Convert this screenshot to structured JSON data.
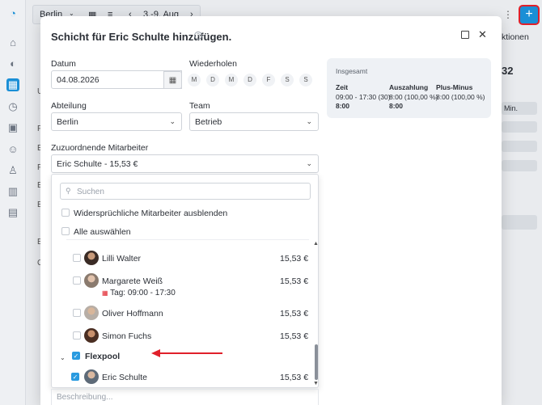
{
  "background": {
    "location": "Berlin",
    "date_range": "3.-9. Aug",
    "actions_label": "ktionen",
    "side_letters": [
      "U",
      "F",
      "E",
      "F",
      "E",
      "E",
      "E",
      "C"
    ],
    "right_value": "32",
    "right_badge": "Min."
  },
  "modal": {
    "title": "Schicht für Eric Schulte hinzufügen.",
    "date_label": "Datum",
    "date_value": "04.08.2026",
    "repeat_label": "Wiederholen",
    "weekdays": [
      "M",
      "D",
      "M",
      "D",
      "F",
      "S",
      "S"
    ],
    "department_label": "Abteilung",
    "department_value": "Berlin",
    "team_label": "Team",
    "team_value": "Betrieb",
    "employees_label": "Zuzuordnende Mitarbeiter",
    "employees_value": "Eric Schulte - 15,53 €",
    "description_placeholder": "Beschreibung..."
  },
  "summary": {
    "title": "Insgesamt",
    "columns": [
      {
        "header": "Zeit",
        "line1": "09:00 - 17:30 (30)",
        "line2": "8:00"
      },
      {
        "header": "Auszahlung",
        "line1": "8:00 (100,00 %)",
        "line2": "8:00"
      },
      {
        "header": "Plus-Minus",
        "line1": "8:00 (100,00 %)",
        "line2": ""
      }
    ]
  },
  "dropdown": {
    "search_placeholder": "Suchen",
    "hide_conflicts": "Widersprüchliche Mitarbeiter ausblenden",
    "select_all": "Alle auswählen",
    "employees": [
      {
        "name": "Lilli Walter",
        "price": "15,53 €",
        "checked": false
      },
      {
        "name": "Margarete Weiß",
        "price": "15,53 €",
        "checked": false,
        "shift": "Tag: 09:00 - 17:30"
      },
      {
        "name": "Oliver Hoffmann",
        "price": "15,53 €",
        "checked": false
      },
      {
        "name": "Simon Fuchs",
        "price": "15,53 €",
        "checked": false
      }
    ],
    "group_name": "Flexpool",
    "group_checked": true,
    "selected_employee": {
      "name": "Eric Schulte",
      "price": "15,53 €",
      "checked": true
    }
  },
  "colors": {
    "accent": "#1a8fd6",
    "annotation_red": "#e0202a"
  }
}
